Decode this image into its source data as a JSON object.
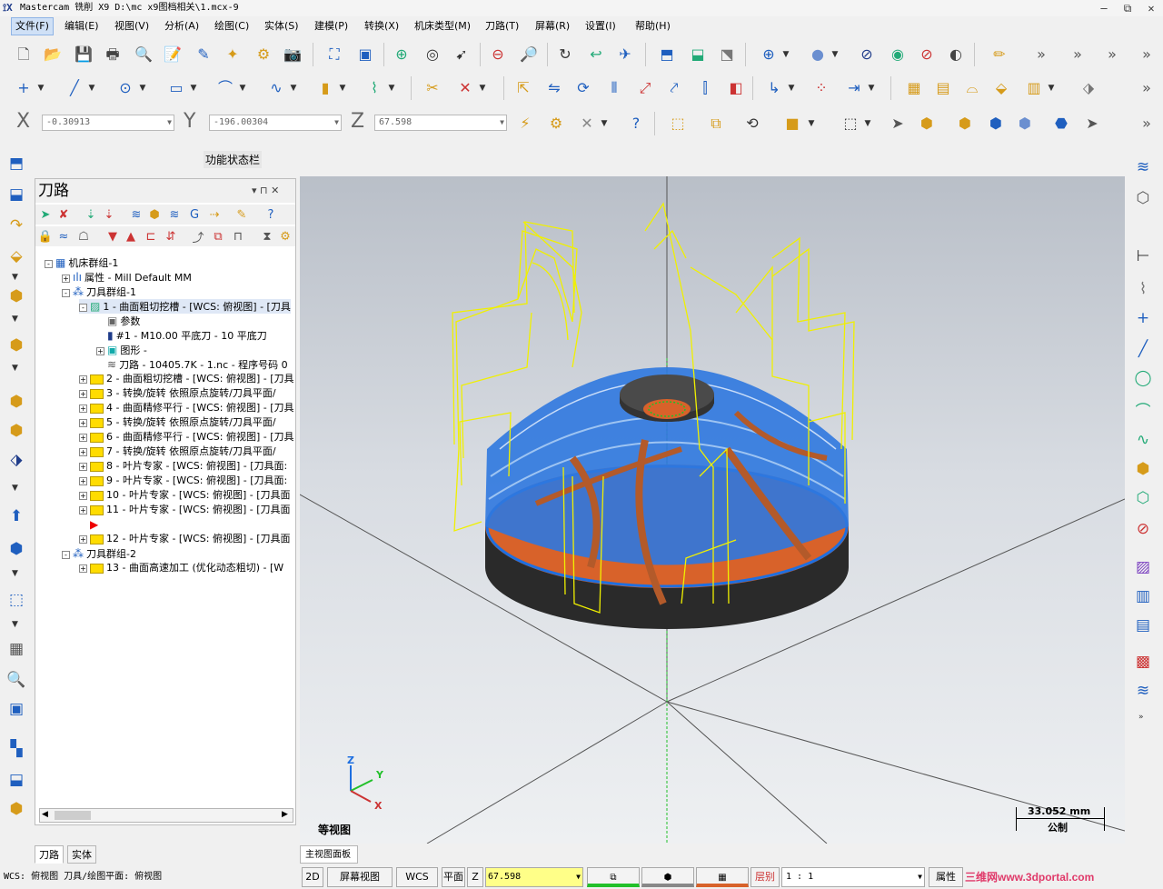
{
  "window": {
    "title": "Mastercam 铣削 X9  D:\\mc x9图档相关\\1.mcx-9",
    "minimize": "—",
    "restore": "⧉",
    "close": "✕"
  },
  "menu": [
    "文件(F)",
    "编辑(E)",
    "视图(V)",
    "分析(A)",
    "绘图(C)",
    "实体(S)",
    "建模(P)",
    "转换(X)",
    "机床类型(M)",
    "刀路(T)",
    "屏幕(R)",
    "设置(I)",
    "帮助(H)"
  ],
  "coords": {
    "x_label": "X",
    "x_value": "-0.30913",
    "y_label": "Y",
    "y_value": "-196.00304",
    "z_label": "Z",
    "z_value": "67.598"
  },
  "function_bar_label": "功能状态栏",
  "panel": {
    "title": "刀路",
    "pin": "▾  ⊓  ✕"
  },
  "tree": [
    {
      "text": "机床群组-1",
      "indent": 0,
      "exp": "-",
      "icon": "group"
    },
    {
      "text": "属性 - Mill Default MM",
      "indent": 1,
      "exp": "+",
      "icon": "prop"
    },
    {
      "text": "刀具群组-1",
      "indent": 1,
      "exp": "-",
      "icon": "toolgroup"
    },
    {
      "text": "1 - 曲面粗切挖槽 - [WCS: 俯视图] - [刀具",
      "indent": 2,
      "exp": "-",
      "icon": "opsel",
      "selected": true
    },
    {
      "text": "参数",
      "indent": 3,
      "exp": "",
      "icon": "param"
    },
    {
      "text": "#1 - M10.00 平底刀 - 10 平底刀",
      "indent": 3,
      "exp": "",
      "icon": "tool"
    },
    {
      "text": "图形 -",
      "indent": 3,
      "exp": "+",
      "icon": "geom"
    },
    {
      "text": "刀路 - 10405.7K - 1.nc - 程序号码 0",
      "indent": 3,
      "exp": "",
      "icon": "path"
    },
    {
      "text": "2 - 曲面粗切挖槽 - [WCS: 俯视图] - [刀具",
      "indent": 2,
      "exp": "+",
      "icon": "folder"
    },
    {
      "text": "3 - 转换/旋转 依照原点旋转/刀具平面/",
      "indent": 2,
      "exp": "+",
      "icon": "folder"
    },
    {
      "text": "4 - 曲面精修平行 - [WCS: 俯视图] - [刀具",
      "indent": 2,
      "exp": "+",
      "icon": "folder"
    },
    {
      "text": "5 - 转换/旋转 依照原点旋转/刀具平面/",
      "indent": 2,
      "exp": "+",
      "icon": "folder"
    },
    {
      "text": "6 - 曲面精修平行 - [WCS: 俯视图] - [刀具",
      "indent": 2,
      "exp": "+",
      "icon": "folder"
    },
    {
      "text": "7 - 转换/旋转 依照原点旋转/刀具平面/",
      "indent": 2,
      "exp": "+",
      "icon": "folder"
    },
    {
      "text": "8 - 叶片专家 - [WCS: 俯视图] - [刀具面:",
      "indent": 2,
      "exp": "+",
      "icon": "folder"
    },
    {
      "text": "9 - 叶片专家 - [WCS: 俯视图] - [刀具面:",
      "indent": 2,
      "exp": "+",
      "icon": "folder"
    },
    {
      "text": "10 - 叶片专家 - [WCS: 俯视图] - [刀具面",
      "indent": 2,
      "exp": "+",
      "icon": "folder"
    },
    {
      "text": "11 - 叶片专家 - [WCS: 俯视图] - [刀具面",
      "indent": 2,
      "exp": "+",
      "icon": "folder"
    },
    {
      "text": "",
      "indent": 2,
      "exp": "",
      "icon": "insert"
    },
    {
      "text": "12 - 叶片专家 - [WCS: 俯视图] - [刀具面",
      "indent": 2,
      "exp": "+",
      "icon": "folder"
    },
    {
      "text": "刀具群组-2",
      "indent": 1,
      "exp": "-",
      "icon": "toolgroup"
    },
    {
      "text": "13 - 曲面高速加工 (优化动态粗切) - [W",
      "indent": 2,
      "exp": "+",
      "icon": "folder"
    }
  ],
  "panel_tabs": [
    "刀路",
    "实体"
  ],
  "viewport": {
    "view_name": "等视图",
    "scale_value": "33.052 mm",
    "scale_unit": "公制",
    "axis_x": "X",
    "axis_y": "Y",
    "axis_z": "Z",
    "tab": "主视图面板"
  },
  "status": {
    "wcs_text": "WCS: 俯视图  刀具/绘图平面: 俯视图",
    "mode": "2D",
    "screen_view": "屏幕视图",
    "wcs": "WCS",
    "plane": "平面",
    "z_label": "Z",
    "z_value": "67.598",
    "level_label": "层别",
    "level_value": "1 : 1",
    "attr": "属性",
    "watermark": "三维网www.3dportal.com"
  },
  "colors": {
    "accent": "#1f5fbf",
    "toolpath_yellow": "#f0f000",
    "toolpath_blue": "#1e6fe0",
    "stock_orange": "#d8622a",
    "green": "#22c02a"
  }
}
